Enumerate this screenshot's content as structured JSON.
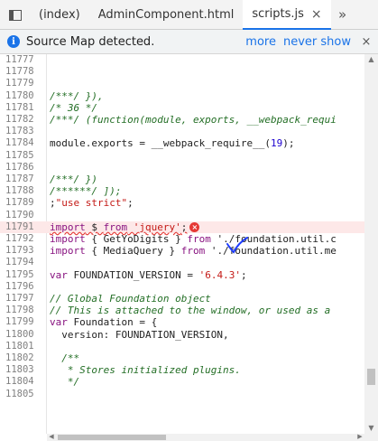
{
  "tabs": [
    {
      "label": "(index)",
      "active": false
    },
    {
      "label": "AdminComponent.html",
      "active": false
    },
    {
      "label": "scripts.js",
      "active": true
    }
  ],
  "tab_close_glyph": "×",
  "overflow_glyph": "»",
  "infobar": {
    "text": "Source Map detected.",
    "more": "more",
    "never_show": "never show",
    "close": "×"
  },
  "code_lines": [
    {
      "n": "11777",
      "text": ""
    },
    {
      "n": "11778",
      "text": ""
    },
    {
      "n": "11779",
      "text": ""
    },
    {
      "n": "11780",
      "text": "/***/ }),"
    },
    {
      "n": "11781",
      "text": "/* 36 */"
    },
    {
      "n": "11782",
      "text": "/***/ (function(module, exports, __webpack_requi"
    },
    {
      "n": "11783",
      "text": ""
    },
    {
      "n": "11784",
      "text": "module.exports = __webpack_require__(19);"
    },
    {
      "n": "11785",
      "text": ""
    },
    {
      "n": "11786",
      "text": ""
    },
    {
      "n": "11787",
      "text": "/***/ })"
    },
    {
      "n": "11788",
      "text": "/******/ ]);"
    },
    {
      "n": "11789",
      "text": ";\"use strict\";"
    },
    {
      "n": "11790",
      "text": ""
    },
    {
      "n": "11791",
      "text": "import $ from 'jquery';",
      "error": true
    },
    {
      "n": "11792",
      "text": "import { GetYoDigits } from './foundation.util.c"
    },
    {
      "n": "11793",
      "text": "import { MediaQuery } from './foundation.util.me"
    },
    {
      "n": "11794",
      "text": ""
    },
    {
      "n": "11795",
      "text": "var FOUNDATION_VERSION = '6.4.3';"
    },
    {
      "n": "11796",
      "text": ""
    },
    {
      "n": "11797",
      "text": "// Global Foundation object"
    },
    {
      "n": "11798",
      "text": "// This is attached to the window, or used as a"
    },
    {
      "n": "11799",
      "text": "var Foundation = {"
    },
    {
      "n": "11800",
      "text": "  version: FOUNDATION_VERSION,"
    },
    {
      "n": "11801",
      "text": ""
    },
    {
      "n": "11802",
      "text": "  /**"
    },
    {
      "n": "11803",
      "text": "   * Stores initialized plugins."
    },
    {
      "n": "11804",
      "text": "   */"
    },
    {
      "n": "11805",
      "text": ""
    }
  ],
  "error_badge": "×",
  "colors": {
    "accent": "#1a73e8",
    "error": "#e53935",
    "annotation": "#1e3cff"
  }
}
